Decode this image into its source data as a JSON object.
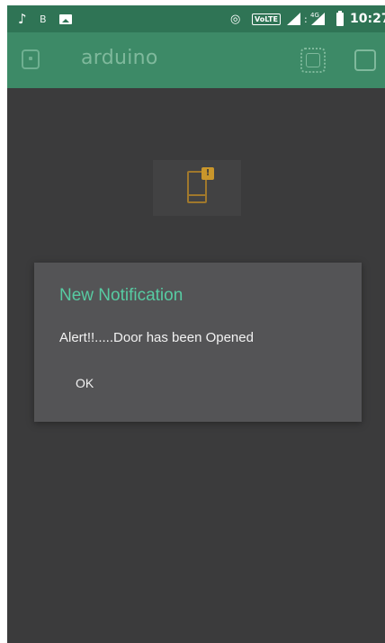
{
  "status_bar": {
    "music_icon": "music-note-icon",
    "b_label": "B",
    "hotspot_icon": "hotspot-icon",
    "volte_label": "VoLTE",
    "colon": ":",
    "network_label": "4G",
    "time": "10:27"
  },
  "app_bar": {
    "title": "arduino"
  },
  "widget": {
    "badge": "!"
  },
  "dialog": {
    "title": "New Notification",
    "message": "Alert!!.....Door has been Opened",
    "ok_label": "OK"
  },
  "colors": {
    "status_bar": "#2f7455",
    "app_bar": "#3d8a67",
    "background": "#3b3b3c",
    "dialog": "#545456",
    "accent": "#57cba2",
    "widget_icon": "#a0782c"
  }
}
